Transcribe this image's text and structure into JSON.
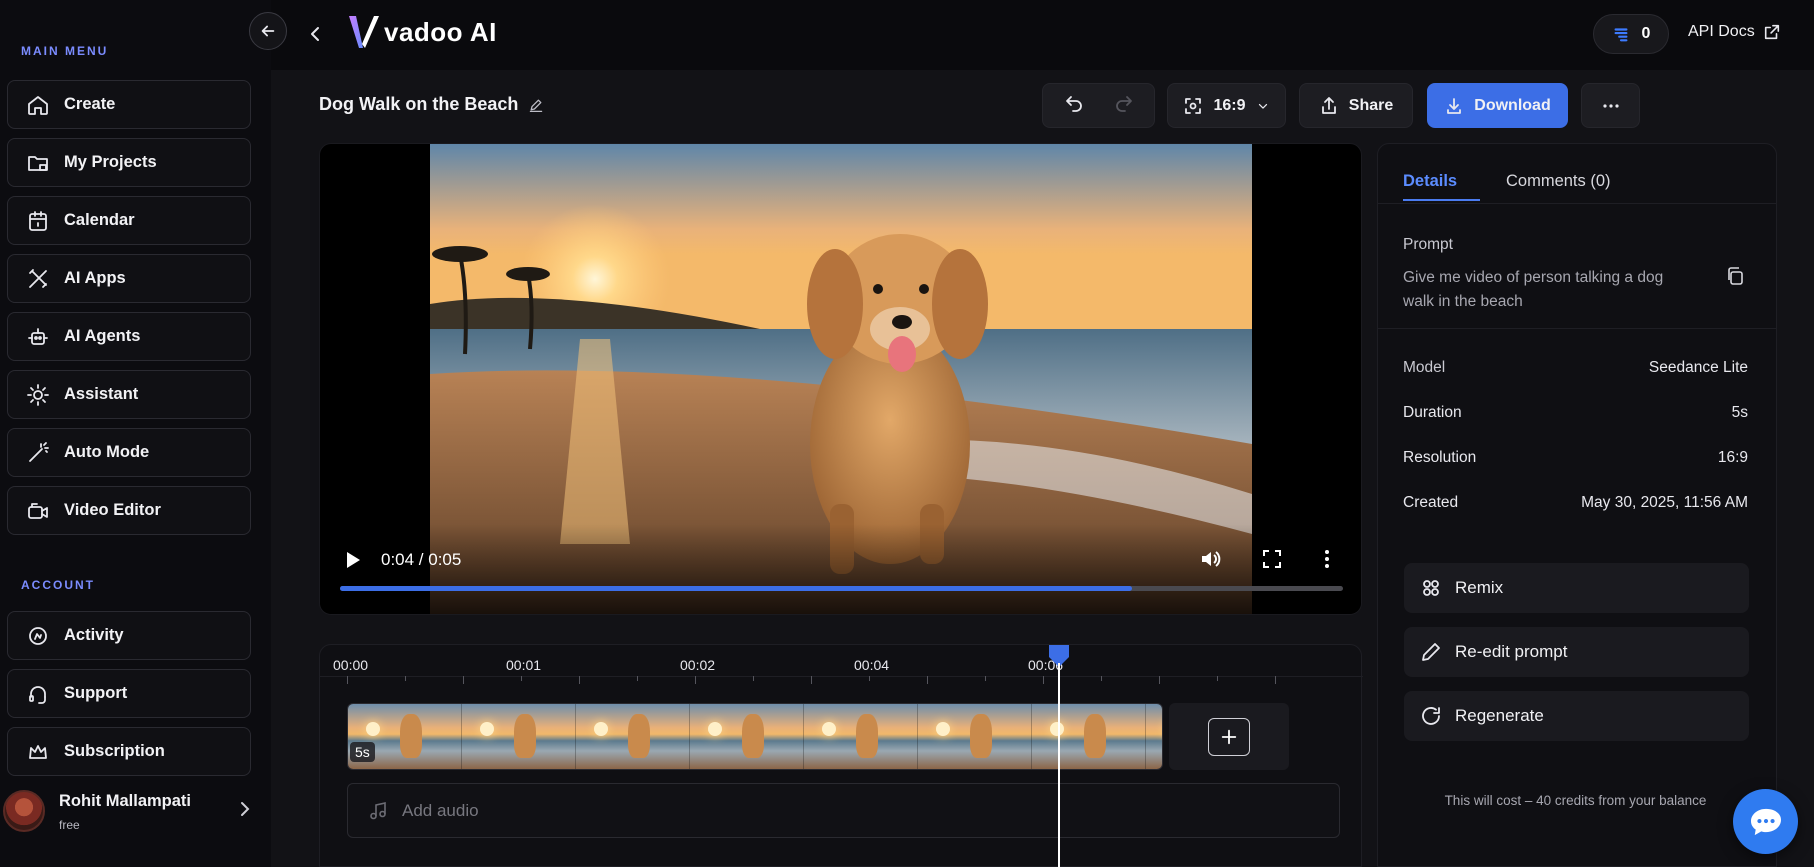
{
  "sidebar": {
    "main_menu_label": "MAIN MENU",
    "main_items": [
      {
        "label": "Create",
        "icon": "home-icon"
      },
      {
        "label": "My Projects",
        "icon": "folder-icon"
      },
      {
        "label": "Calendar",
        "icon": "calendar-icon"
      },
      {
        "label": "AI Apps",
        "icon": "tools-icon"
      },
      {
        "label": "AI Agents",
        "icon": "robot-icon"
      },
      {
        "label": "Assistant",
        "icon": "bulb-icon"
      },
      {
        "label": "Auto Mode",
        "icon": "magic-wand-icon"
      },
      {
        "label": "Video Editor",
        "icon": "video-icon"
      }
    ],
    "account_label": "ACCOUNT",
    "account_items": [
      {
        "label": "Activity",
        "icon": "activity-icon"
      },
      {
        "label": "Support",
        "icon": "headset-icon"
      },
      {
        "label": "Subscription",
        "icon": "crown-icon"
      }
    ],
    "user": {
      "name": "Rohit Mallampati",
      "plan": "free"
    }
  },
  "topbar": {
    "logo_text": "vadoo AI",
    "credits": "0",
    "api_docs": "API Docs"
  },
  "toolbar": {
    "project_title": "Dog Walk on the Beach",
    "aspect_ratio": "16:9",
    "share_label": "Share",
    "download_label": "Download"
  },
  "player": {
    "time_display": "0:04 / 0:05",
    "progress": 0.79
  },
  "timeline": {
    "ticks": [
      "00:00",
      "00:01",
      "00:02",
      "00:04",
      "00:06"
    ],
    "clip_duration": "5s",
    "add_audio": "Add audio",
    "playhead": 0.8
  },
  "details": {
    "tabs": [
      {
        "label": "Details",
        "active": true
      },
      {
        "label": "Comments (0)",
        "active": false
      }
    ],
    "prompt_label": "Prompt",
    "prompt_text": "Give me video of person talking a dog walk in the beach",
    "rows": [
      {
        "label": "Model",
        "value": "Seedance Lite"
      },
      {
        "label": "Duration",
        "value": "5s"
      },
      {
        "label": "Resolution",
        "value": "16:9"
      },
      {
        "label": "Created",
        "value": "May 30, 2025, 11:56 AM"
      }
    ],
    "actions": [
      {
        "label": "Remix",
        "icon": "remix-icon"
      },
      {
        "label": "Re-edit prompt",
        "icon": "pencil-icon"
      },
      {
        "label": "Regenerate",
        "icon": "refresh-icon"
      }
    ],
    "cost_note": "This will cost – 40 credits from your balance"
  },
  "colors": {
    "accent": "#3c6ee6",
    "section_label": "#7b8cff",
    "chat_button": "#2f7bf0"
  }
}
